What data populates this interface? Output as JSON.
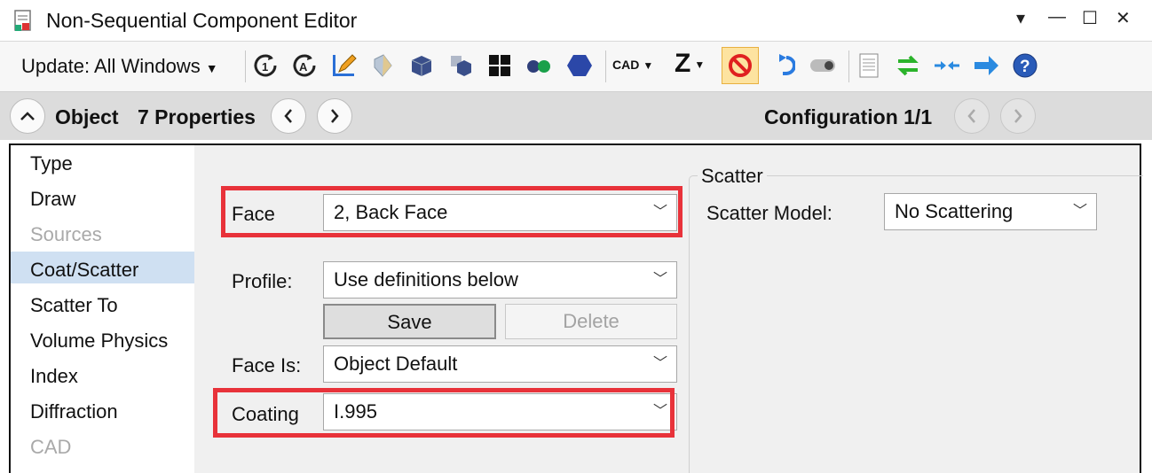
{
  "window": {
    "title": "Non-Sequential Component Editor",
    "controls": [
      "▾",
      "—",
      "☐",
      "✕"
    ]
  },
  "toolbar": {
    "update_label": "Update: All Windows",
    "cad_label": "CAD",
    "z_label": "Z",
    "icons": [
      "refresh-1-icon",
      "refresh-all-icon",
      "edit-pencil-icon",
      "lens-icon",
      "cube-icon",
      "cube-small-icon",
      "grid-icon",
      "dots-icon",
      "hexagon-icon",
      "cad-icon",
      "z-icon",
      "no-icon",
      "undo-icon",
      "toggle-icon",
      "page-icon",
      "swap-arrows-icon",
      "converge-icon",
      "arrow-right-icon",
      "help-icon"
    ]
  },
  "nav": {
    "object_label": "Object",
    "properties_label": "7 Properties",
    "configuration_label": "Configuration 1/1"
  },
  "sidebar": {
    "items": [
      {
        "label": "Type",
        "enabled": true
      },
      {
        "label": "Draw",
        "enabled": true
      },
      {
        "label": "Sources",
        "enabled": false
      },
      {
        "label": "Coat/Scatter",
        "enabled": true,
        "selected": true
      },
      {
        "label": "Scatter To",
        "enabled": true
      },
      {
        "label": "Volume Physics",
        "enabled": true
      },
      {
        "label": "Index",
        "enabled": true
      },
      {
        "label": "Diffraction",
        "enabled": true
      },
      {
        "label": "CAD",
        "enabled": false
      }
    ]
  },
  "form": {
    "face_label": "Face",
    "face_value": "2, Back Face",
    "profile_label": "Profile:",
    "profile_value": "Use definitions below",
    "save_label": "Save",
    "delete_label": "Delete",
    "face_is_label": "Face Is:",
    "face_is_value": "Object Default",
    "coating_label": "Coating",
    "coating_value": "I.995"
  },
  "scatter": {
    "group_title": "Scatter",
    "model_label": "Scatter Model:",
    "model_value": "No Scattering"
  },
  "colors": {
    "highlight": "#e8323a",
    "selection": "#cfe0f2"
  }
}
